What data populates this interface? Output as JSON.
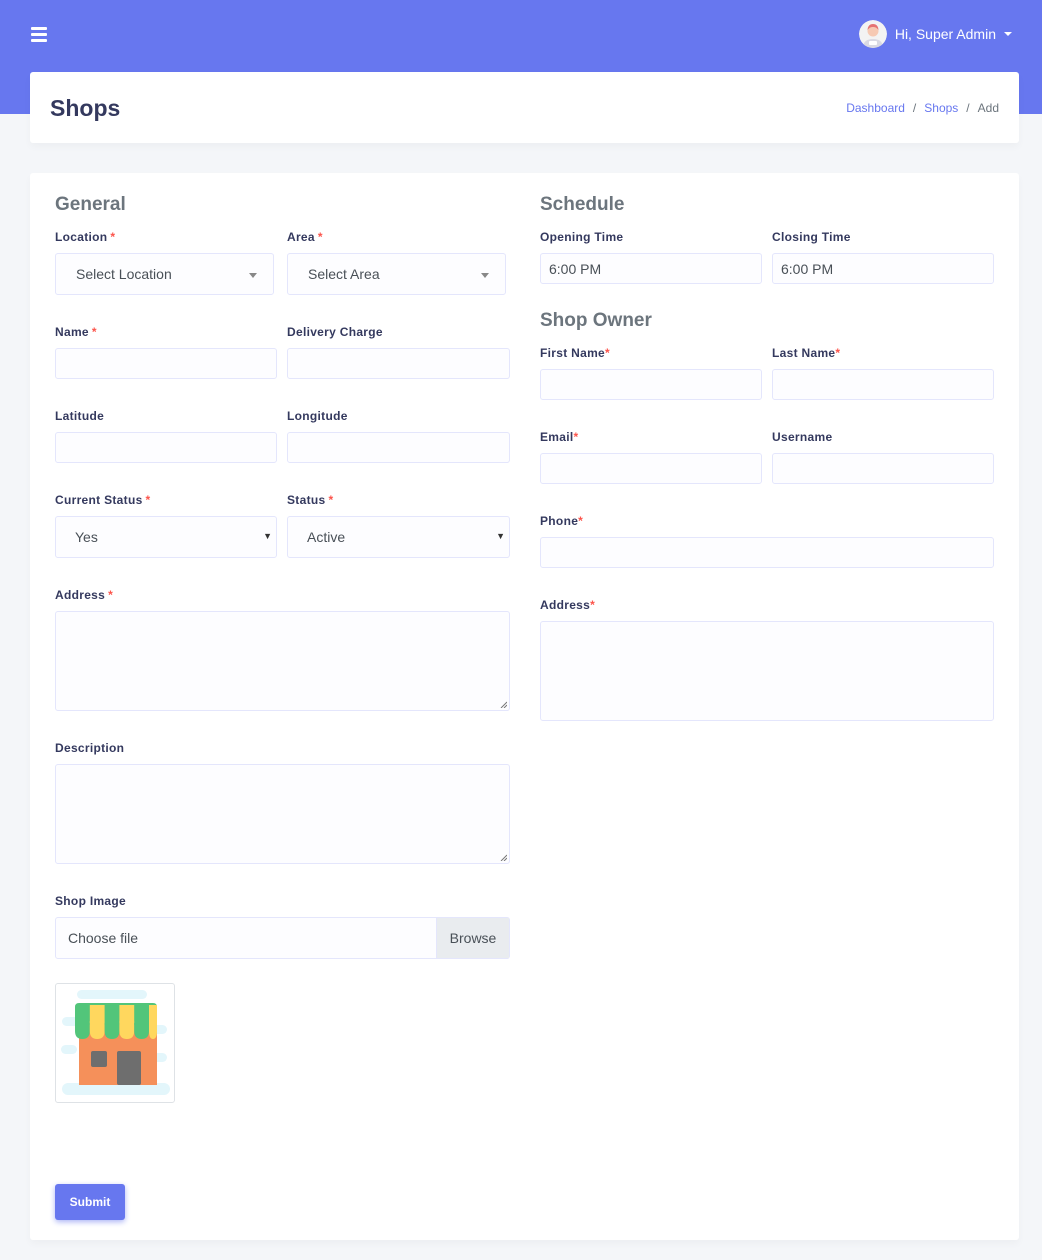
{
  "user": {
    "greeting": "Hi, Super Admin"
  },
  "page": {
    "title": "Shops"
  },
  "breadcrumb": {
    "dashboard": "Dashboard",
    "shops": "Shops",
    "current": "Add",
    "separator": "/"
  },
  "general": {
    "title": "General",
    "location": {
      "label": "Location",
      "value": "Select Location"
    },
    "area": {
      "label": "Area",
      "value": "Select Area"
    },
    "name": {
      "label": "Name",
      "value": ""
    },
    "delivery_charge": {
      "label": "Delivery Charge",
      "value": ""
    },
    "latitude": {
      "label": "Latitude",
      "value": ""
    },
    "longitude": {
      "label": "Longitude",
      "value": ""
    },
    "current_status": {
      "label": "Current Status",
      "value": "Yes"
    },
    "status": {
      "label": "Status",
      "value": "Active"
    },
    "address": {
      "label": "Address"
    },
    "description": {
      "label": "Description"
    },
    "shop_image": {
      "label": "Shop Image",
      "file_text": "Choose file",
      "browse": "Browse"
    }
  },
  "schedule": {
    "title": "Schedule",
    "opening_time": {
      "label": "Opening Time",
      "value": "6:00 PM"
    },
    "closing_time": {
      "label": "Closing Time",
      "value": "6:00 PM"
    }
  },
  "owner": {
    "title": "Shop Owner",
    "first_name": {
      "label": "First Name"
    },
    "last_name": {
      "label": "Last Name"
    },
    "email": {
      "label": "Email"
    },
    "username": {
      "label": "Username"
    },
    "phone": {
      "label": "Phone"
    },
    "address": {
      "label": "Address"
    }
  },
  "required_mark": "*",
  "submit": "Submit",
  "colors": {
    "primary": "#6777ef",
    "required": "#fc544b",
    "background": "#f4f6f9"
  }
}
